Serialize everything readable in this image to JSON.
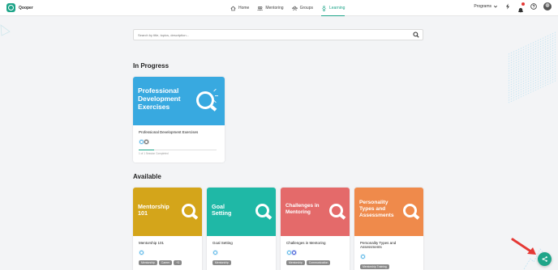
{
  "app": {
    "name": "Qooper"
  },
  "nav": {
    "items": [
      {
        "label": "Home",
        "icon": "home-icon",
        "active": false
      },
      {
        "label": "Mentoring",
        "icon": "mentoring-icon",
        "active": false
      },
      {
        "label": "Groups",
        "icon": "groups-icon",
        "active": false
      },
      {
        "label": "Learning",
        "icon": "learning-icon",
        "active": true
      }
    ]
  },
  "header_tools": {
    "programs_label": "Programs",
    "icons": [
      "bolt-icon",
      "notifications-icon",
      "help-icon",
      "avatar"
    ]
  },
  "search": {
    "placeholder": "Search by title, topics, description..."
  },
  "sections": {
    "in_progress": "In Progress",
    "available": "Available"
  },
  "in_progress_card": {
    "banner_title": "Professional Development Exercises",
    "banner_color": "#38a9e0",
    "title": "Professional Development Exercises",
    "progress_text": "1 of 1 Session Completed",
    "progress_fraction": 0.2
  },
  "available_cards": [
    {
      "banner_title": "Mentorship 101",
      "banner_color": "#d4a51a",
      "title": "Mentorship 101",
      "tags": [
        "Mentorship",
        "Career",
        "+3"
      ]
    },
    {
      "banner_title": "Goal Setting",
      "banner_color": "#1fb8a6",
      "title": "Goal Setting",
      "tags": [
        "Mentorship"
      ]
    },
    {
      "banner_title": "Challenges in Mentoring",
      "banner_color": "#e46a6a",
      "title": "Challenges in Mentoring",
      "tags": [
        "Mentorship",
        "Communication"
      ]
    },
    {
      "banner_title": "Personality Types and Assessments",
      "banner_color": "#ef8a4b",
      "title": "Personality Types and Assessments",
      "tags": [
        "Mentorship Training"
      ]
    }
  ],
  "colors": {
    "accent": "#1ea589",
    "annotation_arrow": "#e53935"
  }
}
